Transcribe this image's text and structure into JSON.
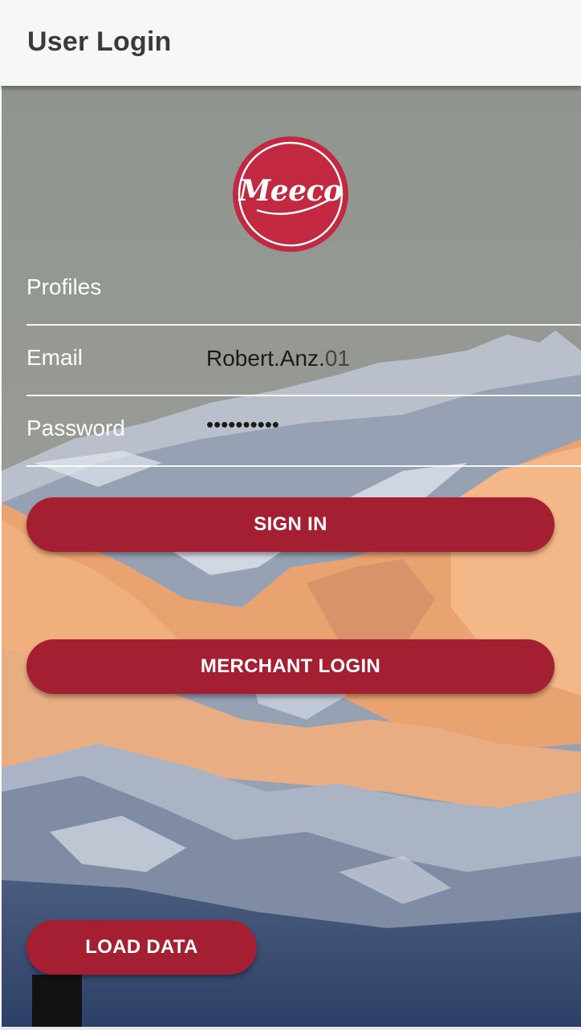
{
  "appbar": {
    "title": "User Login"
  },
  "logo": {
    "text": "Meeco"
  },
  "form": {
    "profiles_label": "Profiles",
    "email_label": "Email",
    "email_value_main": "Robert.Anz.",
    "email_value_selected": "01",
    "password_label": "Password",
    "password_mask": "••••••••••"
  },
  "buttons": {
    "sign_in": "SIGN IN",
    "merchant_login": "MERCHANT LOGIN",
    "load_data": "LOAD DATA"
  },
  "colors": {
    "brand": "#a51f33",
    "logo": "#c2283f",
    "appbar": "#f7f7f7"
  }
}
